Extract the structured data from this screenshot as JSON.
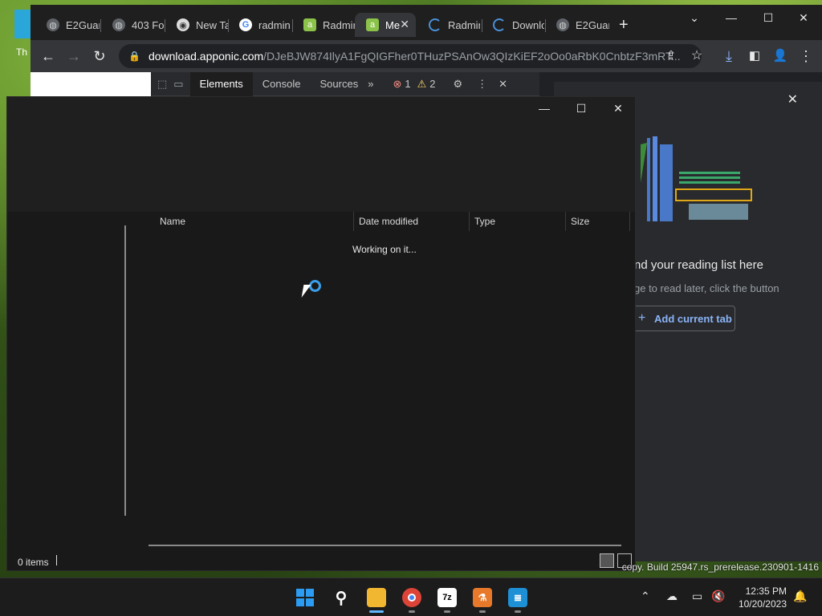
{
  "desktop": {
    "left_text": "Th",
    "build_text": "copy. Build 25947.rs_prerelease.230901-1416"
  },
  "browser": {
    "tabs": [
      {
        "label": "E2Guar",
        "icon": "globe-icon"
      },
      {
        "label": "403 For",
        "icon": "globe-icon"
      },
      {
        "label": "New Ta",
        "icon": "chrome-icon"
      },
      {
        "label": "radmin",
        "icon": "google-icon"
      },
      {
        "label": "Radmir",
        "icon": "apponic-icon"
      },
      {
        "label": "Me",
        "icon": "apponic-icon"
      },
      {
        "label": "Radmin",
        "icon": "loading-icon"
      },
      {
        "label": "Downlo",
        "icon": "loading-icon"
      },
      {
        "label": "E2Guar",
        "icon": "globe-icon"
      }
    ],
    "url_host": "download.apponic.com",
    "url_path": "/DJeBJW874IlyA1FgQIGFher0THuzPSAnOw3QIzKiEF2oOo0aRbK0CnbtzF3mRT..."
  },
  "devtools": {
    "tabs": [
      "Elements",
      "Console",
      "Sources"
    ],
    "errors": "1",
    "warnings": "2"
  },
  "reading_list": {
    "heading": "nd your reading list here",
    "subtext": "ge to read later, click the button",
    "add_button": "Add current tab"
  },
  "file_dialog": {
    "columns": [
      "Name",
      "Date modified",
      "Type",
      "Size"
    ],
    "working_text": "Working on it...",
    "status_items": "0 items"
  },
  "taskbar": {
    "time": "12:35 PM",
    "date": "10/20/2023"
  },
  "colors": {
    "accent": "#3a9ee8",
    "link": "#8ab4f8",
    "chrome_bg": "#202124"
  }
}
